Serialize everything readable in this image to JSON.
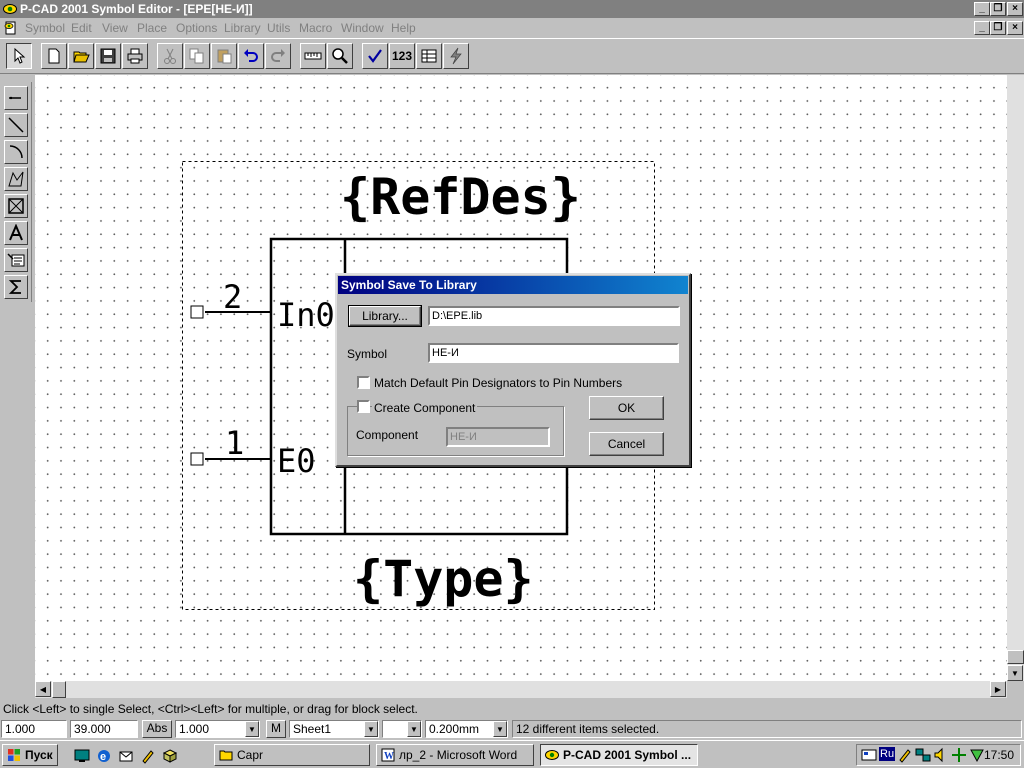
{
  "window": {
    "title": "P-CAD 2001 Symbol Editor - [EPE[НЕ-И]]",
    "controls": [
      "_",
      "❐",
      "×"
    ]
  },
  "menu": [
    "Symbol",
    "Edit",
    "View",
    "Place",
    "Options",
    "Library",
    "Utils",
    "Macro",
    "Window",
    "Help"
  ],
  "toolbar": {
    "numbers_label": "123",
    "tools": [
      "select-arrow",
      "new",
      "open",
      "save",
      "print",
      "cut",
      "copy",
      "paste",
      "undo",
      "redo",
      "measure",
      "zoom",
      "check",
      "numbers",
      "table",
      "power"
    ]
  },
  "palette": [
    "pin",
    "line",
    "arc",
    "polygon",
    "ref-point",
    "text",
    "attribute",
    "sum"
  ],
  "symbol": {
    "refdes": "{RefDes}",
    "type": "{Type}",
    "pins": [
      {
        "number": "2",
        "name": "In0"
      },
      {
        "number": "1",
        "name": "E0"
      }
    ]
  },
  "dialog": {
    "title": "Symbol Save To Library",
    "library_button": "Library...",
    "library_path": "D:\\EPE.lib",
    "symbol_label": "Symbol",
    "symbol_value": "НЕ-И",
    "match_default_label": "Match Default Pin Designators to Pin Numbers",
    "create_component_label": "Create Component",
    "component_label": "Component",
    "component_value": "НЕ-И",
    "ok_label": "OK",
    "cancel_label": "Cancel"
  },
  "status": {
    "hint": "Click <Left> to single Select, <Ctrl><Left> for multiple, or drag for block select.",
    "x": "1.000",
    "y": "39.000",
    "abs_label": "Abs",
    "grid": "1.000",
    "m_label": "M",
    "sheet": "Sheet1",
    "line_width": "0.200mm",
    "selection_info": "12 different items selected."
  },
  "taskbar": {
    "start_label": "Пуск",
    "tasks": [
      {
        "label": "Capr",
        "active": false
      },
      {
        "label": "лр_2 - Microsoft Word",
        "active": false
      },
      {
        "label": "P-CAD 2001 Symbol ...",
        "active": true
      }
    ],
    "lang": "Ru",
    "clock": "17:50"
  },
  "colors": {
    "title_inactive": "#808080",
    "dialog_title_start": "#000080",
    "dialog_title_end": "#1084d0",
    "face": "#c0c0c0"
  }
}
